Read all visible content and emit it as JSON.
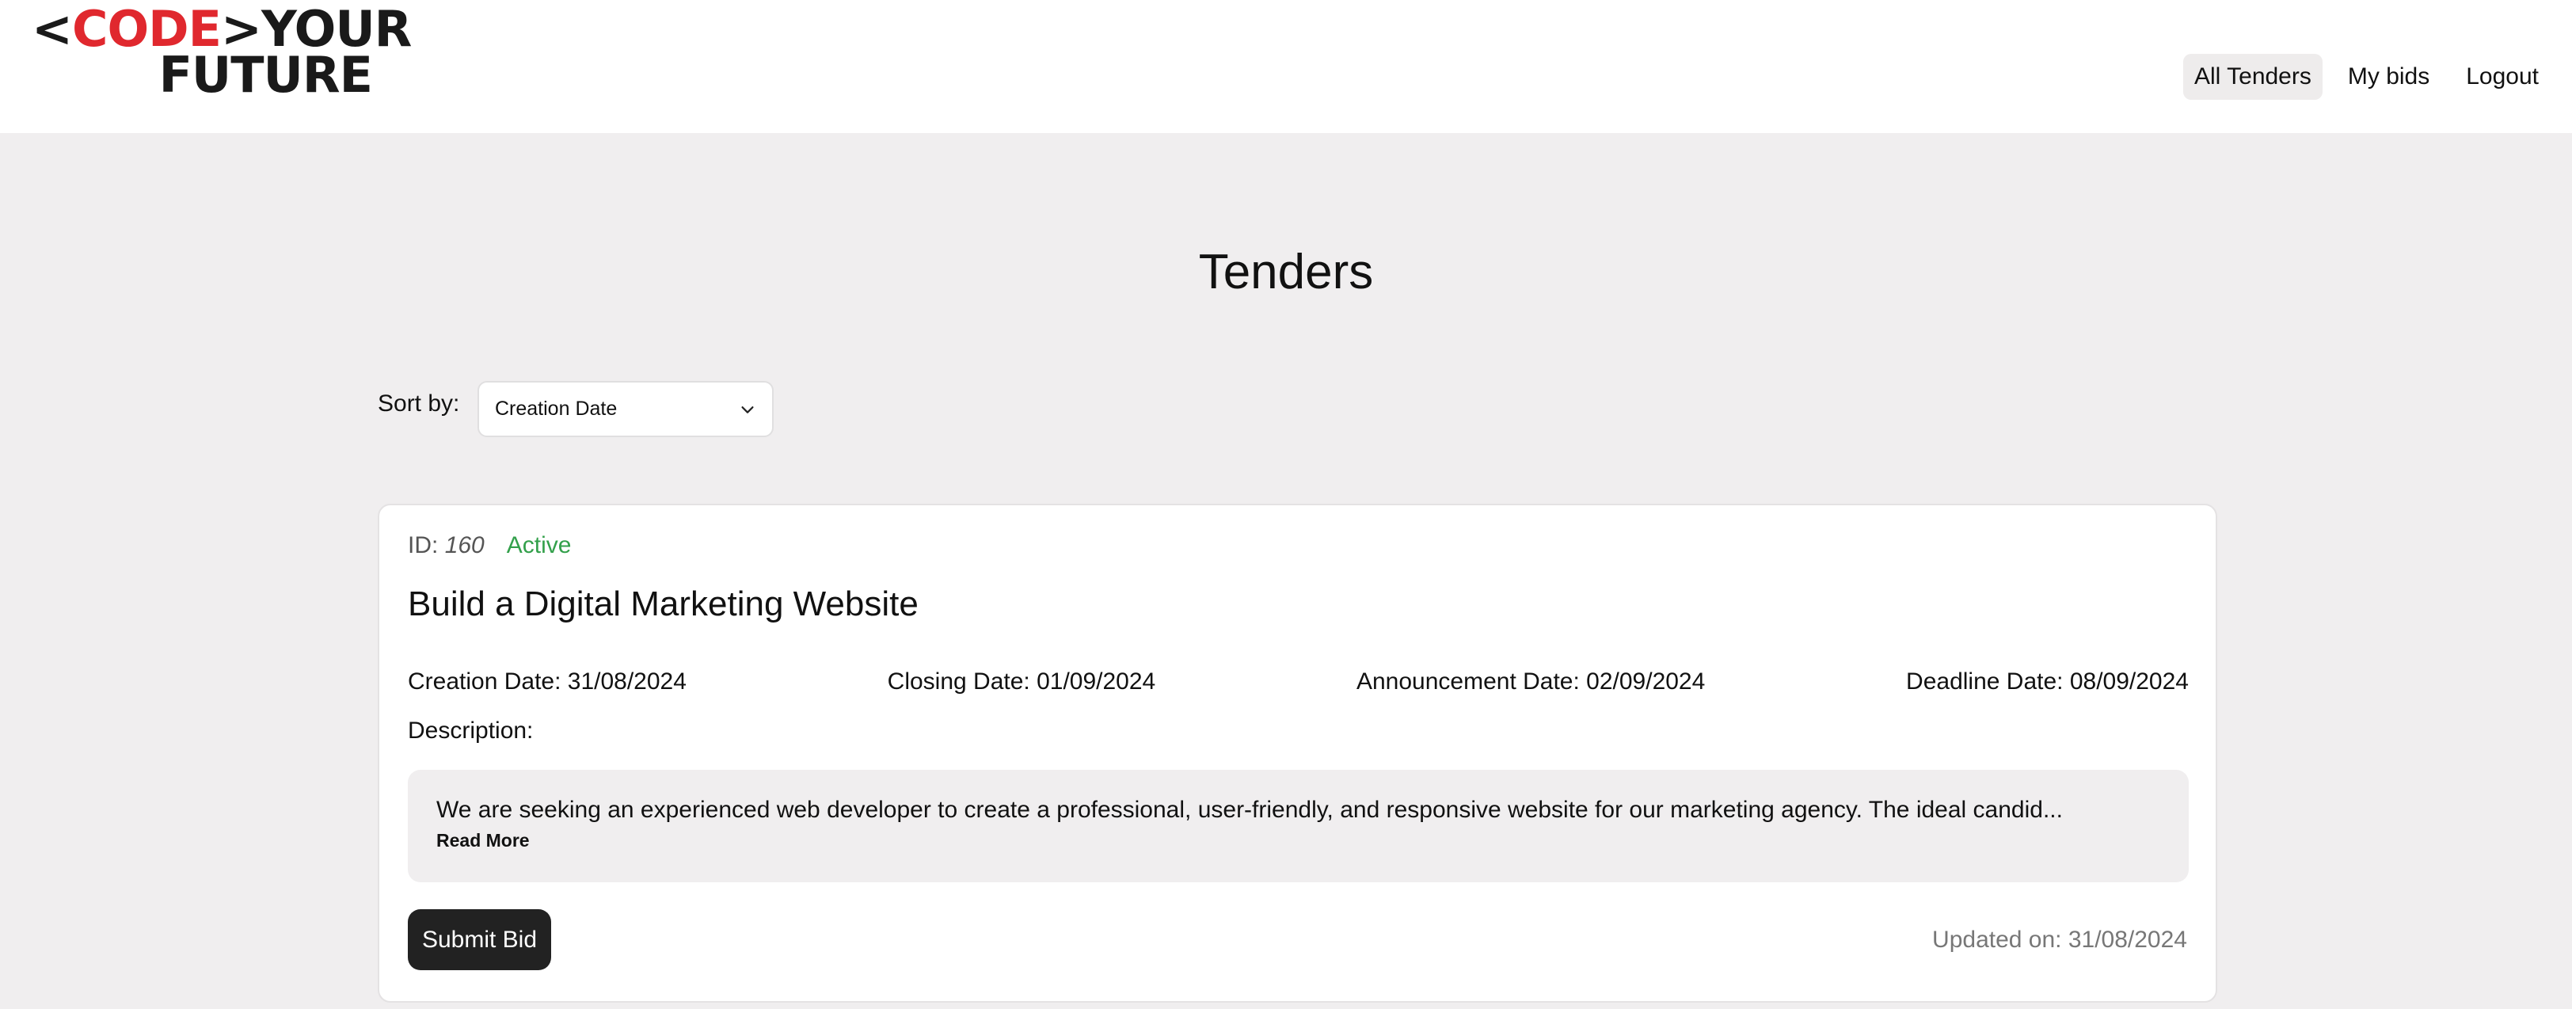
{
  "logo": {
    "lt": "<",
    "code": "CODE",
    "gt": ">",
    "your": "YOUR",
    "future": "FUTURE"
  },
  "nav": {
    "items": [
      {
        "label": "All Tenders",
        "active": true
      },
      {
        "label": "My bids",
        "active": false
      },
      {
        "label": "Logout",
        "active": false
      }
    ]
  },
  "page": {
    "title": "Tenders"
  },
  "sort": {
    "label": "Sort by:",
    "selected": "Creation Date"
  },
  "tender": {
    "id_label": "ID:",
    "id_value": "160",
    "status": "Active",
    "title": "Build a Digital Marketing Website",
    "creation_date": "Creation Date: 31/08/2024",
    "closing_date": "Closing Date: 01/09/2024",
    "announcement_date": "Announcement Date: 02/09/2024",
    "deadline_date": "Deadline Date: 08/09/2024",
    "description_label": "Description:",
    "description": "We are seeking an experienced web developer to create a professional, user-friendly, and responsive website for our marketing agency. The ideal candid...",
    "read_more": "Read More",
    "submit_label": "Submit Bid",
    "updated": "Updated on: 31/08/2024"
  },
  "colors": {
    "brand_red": "#e0282e",
    "status_active": "#33a04b",
    "button_dark": "#222222",
    "page_bg": "#f0eeef"
  }
}
